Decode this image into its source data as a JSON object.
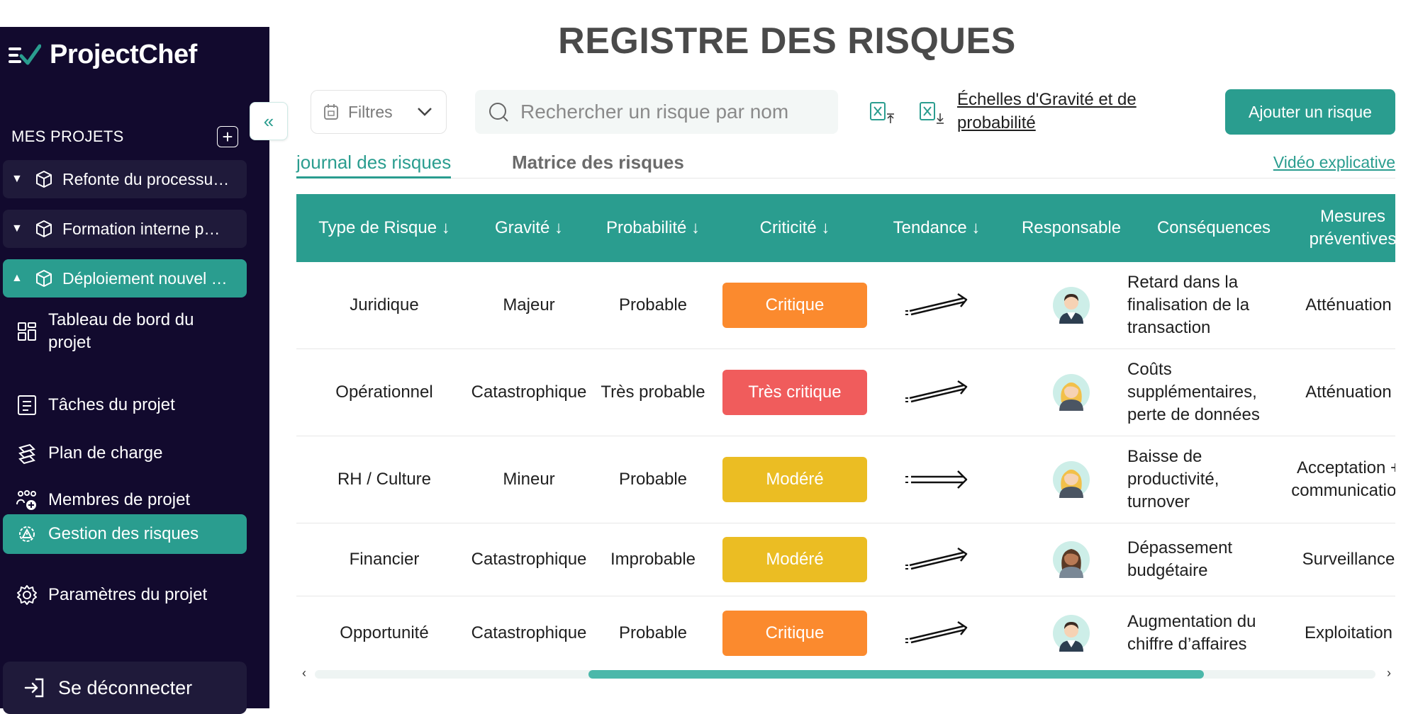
{
  "app": {
    "name": "ProjectChef"
  },
  "sidebar": {
    "section_label": "MES PROJETS",
    "add_symbol": "+",
    "projects": [
      {
        "label": "Refonte du processu…",
        "expanded": false
      },
      {
        "label": "Formation interne p…",
        "expanded": false
      },
      {
        "label": "Déploiement nouvel …",
        "expanded": true
      }
    ],
    "nav": [
      {
        "label": "Tableau de bord du projet",
        "icon": "dashboard-icon"
      },
      {
        "label": "Tâches du projet",
        "icon": "tasks-icon"
      },
      {
        "label": "Plan de charge",
        "icon": "workload-icon"
      },
      {
        "label": "Membres de projet",
        "icon": "members-icon"
      },
      {
        "label": "Gestion des risques",
        "icon": "risk-gear-icon",
        "active": true
      },
      {
        "label": "Paramètres du projet",
        "icon": "settings-icon"
      }
    ],
    "logout": "Se déconnecter",
    "collapse_symbol": "«"
  },
  "header": {
    "title": "REGISTRE DES RISQUES",
    "filter_label": "Filtres",
    "search_placeholder": "Rechercher un risque par nom",
    "scale_link": "Échelles d'Gravité et de probabilité",
    "add_button": "Ajouter un risque"
  },
  "tabs": {
    "active": "journal des risques",
    "inactive": "Matrice des risques",
    "video_link": "Vidéo explicative"
  },
  "table": {
    "columns": [
      "Type de Risque ↓",
      "Gravité ↓",
      "Probabilité ↓",
      "Criticité ↓",
      "Tendance ↓",
      "Responsable",
      "Conséquences",
      "Mesures préventives"
    ],
    "rows": [
      {
        "type": "Juridique",
        "gravite": "Majeur",
        "probabilite": "Probable",
        "criticite": "Critique",
        "criticite_color": "#fb8a2e",
        "tendance": "up",
        "avatar": "man",
        "consequences": "Retard dans la finalisation de la transaction",
        "mesures": "Atténuation"
      },
      {
        "type": "Opérationnel",
        "gravite": "Catastrophique",
        "probabilite": "Très probable",
        "criticite": "Très critique",
        "criticite_color": "#f05c5c",
        "tendance": "up",
        "avatar": "woman-blonde",
        "consequences": "Coûts supplémentaires, perte de données",
        "mesures": "Atténuation"
      },
      {
        "type": "RH / Culture",
        "gravite": "Mineur",
        "probabilite": "Probable",
        "criticite": "Modéré",
        "criticite_color": "#ebbd23",
        "tendance": "flat",
        "avatar": "woman-blonde",
        "consequences": "Baisse de productivité, turnover",
        "mesures": "Acceptation + communication"
      },
      {
        "type": "Financier",
        "gravite": "Catastrophique",
        "probabilite": "Improbable",
        "criticite": "Modéré",
        "criticite_color": "#ebbd23",
        "tendance": "up",
        "avatar": "woman-brown",
        "consequences": "Dépassement budgétaire",
        "mesures": "Surveillance"
      },
      {
        "type": "Opportunité",
        "gravite": "Catastrophique",
        "probabilite": "Probable",
        "criticite": "Critique",
        "criticite_color": "#fb8a2e",
        "tendance": "up",
        "avatar": "man",
        "consequences": "Augmentation du chiffre d’affaires",
        "mesures": "Exploitation"
      }
    ]
  },
  "colors": {
    "accent": "#2a9d8f",
    "sidebar": "#120a2e",
    "title": "#4a4a4a"
  }
}
